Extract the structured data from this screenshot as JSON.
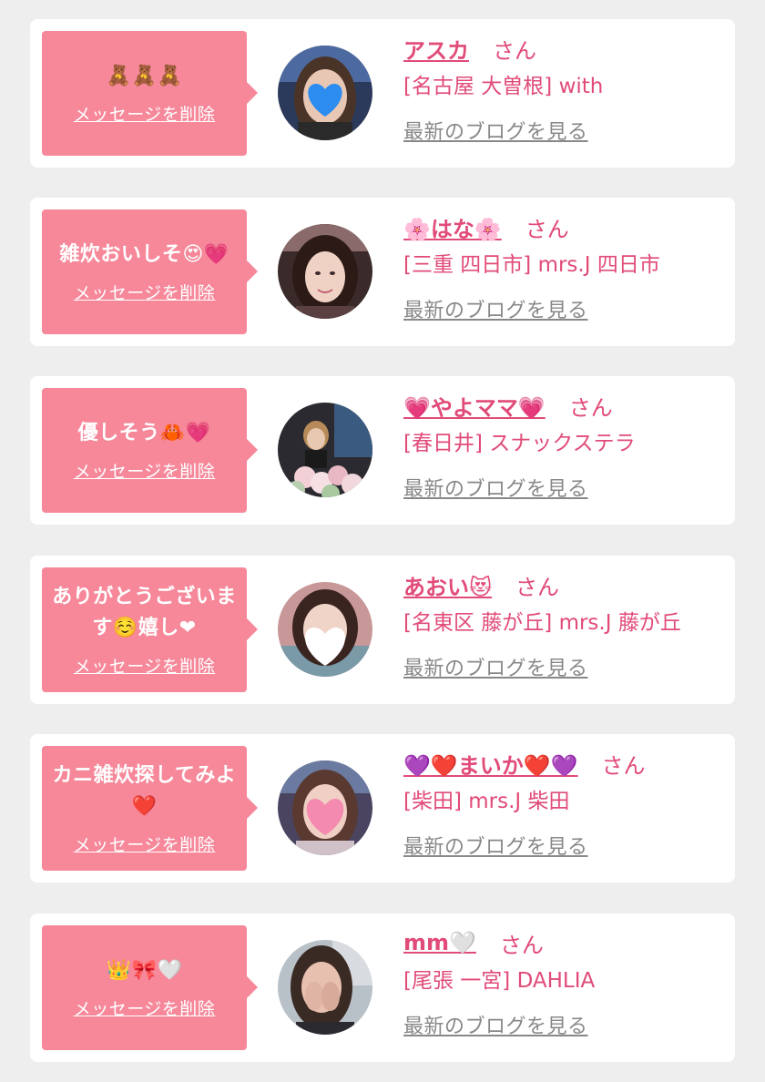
{
  "cards": [
    {
      "message": "🧸🧸🧸",
      "delete_label": "メッセージを削除",
      "name": "アスカ",
      "honorific": "さん",
      "shop": "[名古屋 大曽根] with",
      "blog_label": "最新のブログを見る",
      "avatar_icon": "blue-heart-sticker-face-icon"
    },
    {
      "message": "雑炊おいしそ😍💗",
      "delete_label": "メッセージを削除",
      "name": "🌸はな🌸",
      "honorific": "さん",
      "shop": "[三重 四日市] mrs.J 四日市",
      "blog_label": "最新のブログを見る",
      "avatar_icon": "woman-portrait-icon"
    },
    {
      "message": "優しそう🦀💗",
      "delete_label": "メッセージを削除",
      "name": "💗やよママ💗",
      "honorific": "さん",
      "shop": "[春日井] スナックステラ",
      "blog_label": "最新のブログを見る",
      "avatar_icon": "woman-with-flowers-icon"
    },
    {
      "message": "ありがとうございます☺️嬉し❤",
      "delete_label": "メッセージを削除",
      "name": "あおい😻",
      "honorific": "さん",
      "shop": "[名東区 藤が丘] mrs.J 藤が丘",
      "blog_label": "最新のブログを見る",
      "avatar_icon": "white-heart-sticker-face-icon"
    },
    {
      "message": "カニ雑炊探してみよ❤️",
      "delete_label": "メッセージを削除",
      "name": "💜❤️まいか❤️💜",
      "honorific": "さん",
      "shop": "[柴田] mrs.J 柴田",
      "blog_label": "最新のブログを見る",
      "avatar_icon": "pink-heart-sticker-face-icon"
    },
    {
      "message": "👑🎀🤍",
      "delete_label": "メッセージを削除",
      "name": "mm🤍",
      "honorific": "さん",
      "shop": "[尾張 一宮] DAHLIA",
      "blog_label": "最新のブログを見る",
      "avatar_icon": "woman-covering-face-icon"
    }
  ],
  "colors": {
    "page_bg": "#eeeeee",
    "card_bg": "#ffffff",
    "bubble_bg": "#f6889a",
    "name_pink": "#e14b78",
    "link_gray": "#888888"
  }
}
